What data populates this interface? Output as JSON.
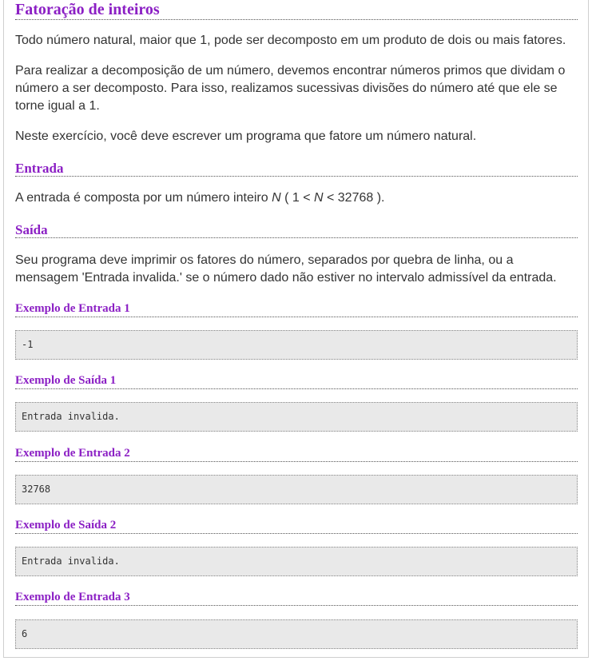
{
  "title": "Fatoração de inteiros",
  "intro": [
    "Todo número natural, maior que 1, pode ser decomposto em um produto de dois ou mais fatores.",
    "Para realizar a decomposição de um número, devemos encontrar números primos que dividam o número a ser decomposto. Para isso, realizamos sucessivas divisões do número até que ele se torne igual a 1.",
    "Neste exercício, você deve escrever um programa que fatore um número natural."
  ],
  "input_section": {
    "heading": "Entrada",
    "text_before": "A entrada é composta por um número inteiro ",
    "var": "N",
    "range_open": " ( 1 < ",
    "var2": "N",
    "range_close": " < 32768 )."
  },
  "output_section": {
    "heading": "Saída",
    "text": "Seu programa deve imprimir os fatores do número, separados por quebra de linha, ou a mensagem 'Entrada invalida.' se o número dado não estiver no intervalo admissível da entrada."
  },
  "examples": [
    {
      "heading": "Exemplo de Entrada 1",
      "content": "-1"
    },
    {
      "heading": "Exemplo de Saída 1",
      "content": "Entrada invalida."
    },
    {
      "heading": "Exemplo de Entrada 2",
      "content": "32768"
    },
    {
      "heading": "Exemplo de Saída 2",
      "content": "Entrada invalida."
    },
    {
      "heading": "Exemplo de Entrada 3",
      "content": "6"
    }
  ]
}
